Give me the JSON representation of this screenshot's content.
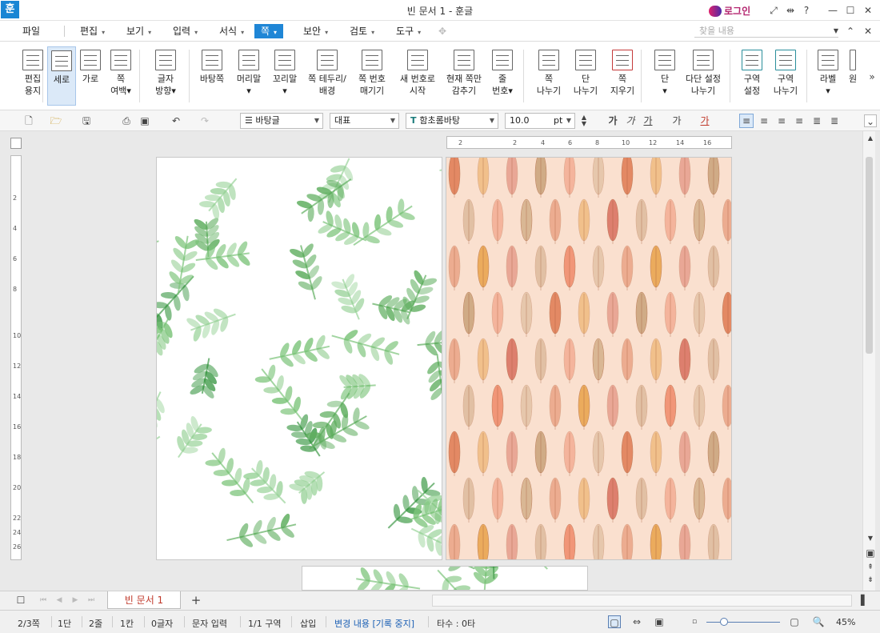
{
  "title": {
    "app_logo": "훈",
    "window_title": "빈 문서 1 - 훈글",
    "login": "로그인",
    "icons": [
      "fullscreen-icon",
      "split-icon",
      "help-icon",
      "minimize-icon",
      "maximize-icon",
      "close-icon"
    ]
  },
  "menubar": {
    "items": [
      {
        "label": "파일",
        "has_dropdown": false
      },
      {
        "label": "편집",
        "has_dropdown": true
      },
      {
        "label": "보기",
        "has_dropdown": true
      },
      {
        "label": "입력",
        "has_dropdown": true
      },
      {
        "label": "서식",
        "has_dropdown": true
      },
      {
        "label": "쪽",
        "has_dropdown": true,
        "active": true
      },
      {
        "label": "보안",
        "has_dropdown": true
      },
      {
        "label": "검토",
        "has_dropdown": true
      },
      {
        "label": "도구",
        "has_dropdown": true
      }
    ],
    "search_placeholder": "찾을 내용",
    "dropdown_marker": "▾",
    "active_color": "#1f86d6"
  },
  "ribbon": {
    "buttons": [
      {
        "line1": "편집",
        "line2": "용지"
      },
      {
        "line1": "세로",
        "line2": "",
        "selected": true
      },
      {
        "line1": "가로",
        "line2": ""
      },
      {
        "line1": "쪽",
        "line2": "여백▾"
      },
      {
        "line1": "글자",
        "line2": "방향▾"
      },
      {
        "line1": "바탕쪽",
        "line2": ""
      },
      {
        "line1": "머리말",
        "line2": "▾"
      },
      {
        "line1": "꼬리말",
        "line2": "▾"
      },
      {
        "line1": "쪽 테두리/",
        "line2": "배경"
      },
      {
        "line1": "쪽 번호",
        "line2": "매기기"
      },
      {
        "line1": "새 번호로",
        "line2": "시작"
      },
      {
        "line1": "현재 쪽만",
        "line2": "감추기"
      },
      {
        "line1": "줄",
        "line2": "번호▾"
      },
      {
        "line1": "쪽",
        "line2": "나누기"
      },
      {
        "line1": "단",
        "line2": "나누기"
      },
      {
        "line1": "쪽",
        "line2": "지우기"
      },
      {
        "line1": "단",
        "line2": "▾"
      },
      {
        "line1": "다단 설정",
        "line2": "나누기"
      },
      {
        "line1": "구역",
        "line2": "설정"
      },
      {
        "line1": "구역",
        "line2": "나누기"
      },
      {
        "line1": "라벨",
        "line2": "▾"
      },
      {
        "line1": "원",
        "line2": ""
      }
    ],
    "more": "»"
  },
  "format": {
    "style": "바탕글",
    "lang": "대표",
    "font": "함초롬바탕",
    "size": "10.0",
    "unit": "pt",
    "char_buttons": [
      "가",
      "가",
      "가",
      "가",
      "가"
    ]
  },
  "rulers": {
    "h_labels": [
      "2",
      "2",
      "4",
      "6",
      "8",
      "10",
      "12",
      "14",
      "16"
    ],
    "v_labels": [
      "2",
      "4",
      "6",
      "8",
      "10",
      "12",
      "14",
      "16",
      "18",
      "20",
      "22",
      "24",
      "26"
    ]
  },
  "document": {
    "left_page_pattern": "green-leaf-pattern",
    "right_page_pattern": "autumn-leaf-pattern",
    "left_bg": "#ffffff",
    "right_bg": "#fae0cf"
  },
  "tabs": {
    "doc_tab": "빈 문서 1",
    "add_label": "+"
  },
  "status": {
    "page": "2/3쪽",
    "dan": "1단",
    "line": "2줄",
    "col": "1칸",
    "chars": "0글자",
    "mode": "문자 입력",
    "section": "1/1 구역",
    "insert": "삽입",
    "track": "변경 내용 [기록 중지]",
    "stroke": "타수 : 0타",
    "zoom": "45%"
  }
}
